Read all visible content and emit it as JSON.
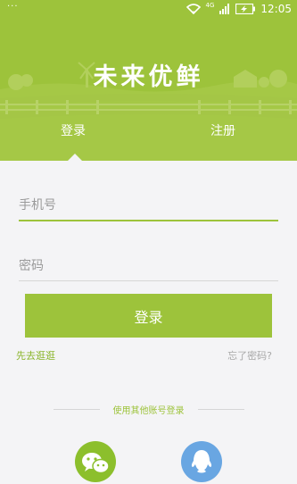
{
  "status_bar": {
    "dots": "···",
    "network": "4G",
    "time": "12:05"
  },
  "brand": {
    "title": "未来优鲜"
  },
  "tabs": [
    {
      "label": "登录",
      "active": true
    },
    {
      "label": "注册",
      "active": false
    }
  ],
  "form": {
    "phone_placeholder": "手机号",
    "password_placeholder": "密码",
    "login_button": "登录"
  },
  "links": {
    "browse": "先去逛逛",
    "forgot": "忘了密码?"
  },
  "other_login": {
    "label": "使用其他账号登录",
    "providers": [
      {
        "name": "wechat",
        "icon": "wechat-icon"
      },
      {
        "name": "qq",
        "icon": "qq-icon"
      }
    ]
  },
  "colors": {
    "brand_green": "#9dc33b",
    "background": "#f4f4f6",
    "qq_blue": "#69a6e2"
  }
}
